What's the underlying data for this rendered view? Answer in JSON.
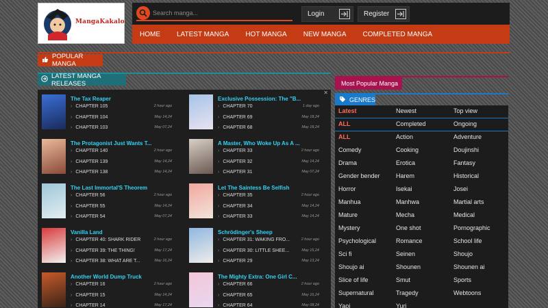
{
  "brand": {
    "logo_text": "MangaKakalot"
  },
  "search": {
    "placeholder": "Search manga..."
  },
  "auth": {
    "login": "Login",
    "register": "Register"
  },
  "nav": [
    "HOME",
    "LATEST MANGA",
    "HOT MANGA",
    "NEW MANGA",
    "COMPLETED MANGA"
  ],
  "sections": {
    "popular": "POPULAR MANGA",
    "latest": "LATEST MANGA RELEASES",
    "most_popular": "Most Popular Manga",
    "genres": "GENRES"
  },
  "latest": [
    {
      "title": "The Tax Reaper",
      "cover": [
        "#3a6fd8",
        "#1a2a5a"
      ],
      "chapters": [
        {
          "name": "CHAPTER 105",
          "time": "2 hour ago"
        },
        {
          "name": "CHAPTER 104",
          "time": "May 14,24"
        },
        {
          "name": "CHAPTER 103",
          "time": "May 07,24"
        }
      ]
    },
    {
      "title": "Exclusive Possession: The \"B...",
      "cover": [
        "#a6c4e8",
        "#e9e2f0"
      ],
      "chapters": [
        {
          "name": "CHAPTER 70",
          "time": "1 day ago"
        },
        {
          "name": "CHAPTER 69",
          "time": "May 18,24"
        },
        {
          "name": "CHAPTER 68",
          "time": "May 18,24"
        }
      ]
    },
    {
      "title": "The Protagonist Just Wants T...",
      "cover": [
        "#e9b99a",
        "#8a4a3a"
      ],
      "chapters": [
        {
          "name": "CHAPTER 140",
          "time": "2 hour ago"
        },
        {
          "name": "CHAPTER 139",
          "time": "May 14,24"
        },
        {
          "name": "CHAPTER 138",
          "time": "May 14,24"
        }
      ]
    },
    {
      "title": "A Master, Who Woke Up As A ...",
      "cover": [
        "#d8cfc6",
        "#6a5a52"
      ],
      "chapters": [
        {
          "name": "CHAPTER 33",
          "time": "2 hour ago"
        },
        {
          "name": "CHAPTER 32",
          "time": "May 14,24"
        },
        {
          "name": "CHAPTER 31",
          "time": "May 07,24"
        }
      ]
    },
    {
      "title": "The Last Immortal'S Theorem",
      "cover": [
        "#9fc6d8",
        "#e2eef2"
      ],
      "chapters": [
        {
          "name": "CHAPTER 56",
          "time": "2 hour ago"
        },
        {
          "name": "CHAPTER 55",
          "time": "May 14,24"
        },
        {
          "name": "CHAPTER 54",
          "time": "May 07,24"
        }
      ]
    },
    {
      "title": "Let The Saintess Be Selfish",
      "cover": [
        "#f0a8a0",
        "#f3e3d8"
      ],
      "chapters": [
        {
          "name": "CHAPTER 35",
          "time": "2 hour ago"
        },
        {
          "name": "CHAPTER 34",
          "time": "May 14,24"
        },
        {
          "name": "CHAPTER 33",
          "time": "May 14,24"
        }
      ]
    },
    {
      "title": "Vanilla Land",
      "cover": [
        "#d93b3b",
        "#f2f2f2"
      ],
      "chapters": [
        {
          "name": "CHAPTER 40: SHARK RIDER",
          "time": "2 hour ago"
        },
        {
          "name": "CHAPTER 39: THE THING!",
          "time": "May 17,24"
        },
        {
          "name": "CHAPTER 38: WHAT ARE T...",
          "time": "May 16,24"
        }
      ]
    },
    {
      "title": "Schrödinger's Sheep",
      "cover": [
        "#8fb7e0",
        "#f0ecea"
      ],
      "chapters": [
        {
          "name": "CHAPTER 31: WAKING FRO...",
          "time": "2 hour ago"
        },
        {
          "name": "CHAPTER 30: LITTLE SHEE...",
          "time": "May 15,24"
        },
        {
          "name": "CHAPTER 29",
          "time": "May 13,24"
        }
      ]
    },
    {
      "title": "Another World Dump Truck",
      "cover": [
        "#c85a2a",
        "#3a2418"
      ],
      "chapters": [
        {
          "name": "CHAPTER 16",
          "time": "2 hour ago"
        },
        {
          "name": "CHAPTER 15",
          "time": "May 14,24"
        },
        {
          "name": "CHAPTER 14",
          "time": "May 17,24"
        }
      ]
    },
    {
      "title": "The Mighty Extra: One Girl C...",
      "cover": [
        "#f3c6d8",
        "#e8d8f0"
      ],
      "chapters": [
        {
          "name": "CHAPTER 66",
          "time": "2 hour ago"
        },
        {
          "name": "CHAPTER 65",
          "time": "May 16,24"
        },
        {
          "name": "CHAPTER 64",
          "time": "May 08,24"
        }
      ]
    }
  ],
  "genres": [
    [
      "Latest",
      "Newest",
      "Top view"
    ],
    [
      "ALL",
      "Completed",
      "Ongoing"
    ],
    [
      "ALL",
      "Action",
      "Adventure"
    ],
    [
      "Comedy",
      "Cooking",
      "Doujinshi"
    ],
    [
      "Drama",
      "Erotica",
      "Fantasy"
    ],
    [
      "Gender bender",
      "Harem",
      "Historical"
    ],
    [
      "Horror",
      "Isekai",
      "Josei"
    ],
    [
      "Manhua",
      "Manhwa",
      "Martial arts"
    ],
    [
      "Mature",
      "Mecha",
      "Medical"
    ],
    [
      "Mystery",
      "One shot",
      "Pornographic"
    ],
    [
      "Psychological",
      "Romance",
      "School life"
    ],
    [
      "Sci fi",
      "Seinen",
      "Shoujo"
    ],
    [
      "Shoujo ai",
      "Shounen",
      "Shounen ai"
    ],
    [
      "Slice of life",
      "Smut",
      "Sports"
    ],
    [
      "Supernatural",
      "Tragedy",
      "Webtoons"
    ],
    [
      "Yaoi",
      "Yuri",
      ""
    ]
  ],
  "colors": {
    "accent_orange": "#c53b14",
    "accent_teal": "#1f6f78",
    "accent_magenta": "#a8124e",
    "accent_blue": "#1a7ac9",
    "title_cyan": "#33d1f2",
    "genre_red": "#ff6a55"
  },
  "icons": {
    "search": "magnifier-icon",
    "login": "enter-icon",
    "register": "enter-icon",
    "popular": "thumbs-up-icon",
    "latest": "arrow-circle-icon",
    "genres": "tag-icon"
  }
}
